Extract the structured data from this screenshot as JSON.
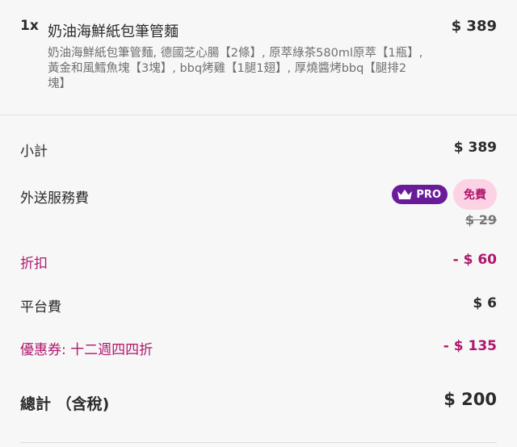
{
  "item": {
    "quantity": "1x",
    "name": "奶油海鮮紙包筆管麵",
    "price": "$ 389",
    "description_lines": [
      "奶油海鮮紙包筆管麵, 德國芝心腸【2條】, 原萃綠茶580ml原萃【1瓶】,",
      "黃金和風鱈魚塊【3塊】, bbq烤雞【1腿1翅】, 厚燒醬烤bbq【腿排2",
      "塊】"
    ]
  },
  "summary": {
    "subtotal": {
      "label": "小計",
      "value": "$ 389"
    },
    "delivery": {
      "label": "外送服務費",
      "pro_badge": "PRO",
      "free_badge": "免費",
      "original_fee": "$ 29"
    },
    "discount": {
      "label": "折扣",
      "value": "- $ 60"
    },
    "platform_fee": {
      "label": "平台費",
      "value": "$ 6"
    },
    "voucher": {
      "label": "優惠券: 十二週四四折",
      "value": "- $ 135"
    },
    "total": {
      "label": "總計 （含稅)",
      "value": "$ 200"
    }
  },
  "colors": {
    "accent_pink": "#b0166d",
    "pro_purple": "#6a1b9a",
    "free_badge_bg": "#fbd3e5"
  },
  "icons": {
    "pro_badge_icon": "crown-icon"
  }
}
